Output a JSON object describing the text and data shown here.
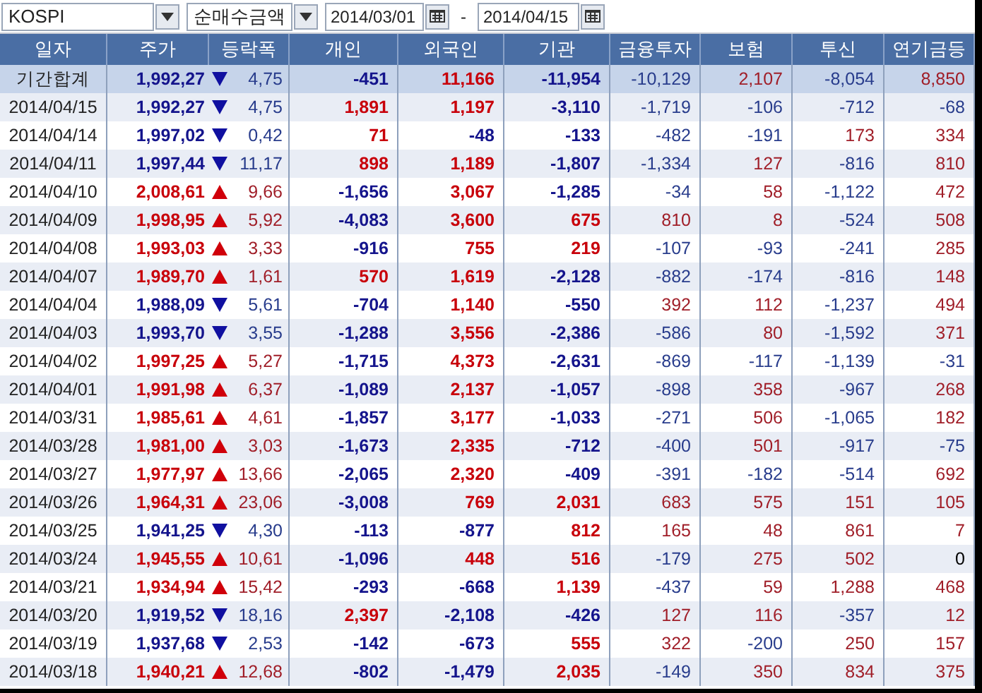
{
  "toolbar": {
    "market_select": {
      "value": "KOSPI"
    },
    "type_select": {
      "value": "순매수금액"
    },
    "date_from": {
      "value": "2014/03/01"
    },
    "separator": "-",
    "date_to": {
      "value": "2014/04/15"
    }
  },
  "table": {
    "columns": [
      "일자",
      "주가",
      "등락폭",
      "개인",
      "외국인",
      "기관",
      "금융투자",
      "보험",
      "투신",
      "연기금등"
    ],
    "rows": [
      {
        "kind": "total",
        "date": "기간합계",
        "price": "1,992,27",
        "rising": false,
        "change": "4,75",
        "values": [
          "-451",
          "11,166",
          "-11,954",
          "-10,129",
          "2,107",
          "-8,054",
          "8,850"
        ]
      },
      {
        "kind": "day",
        "date": "2014/04/15",
        "price": "1,992,27",
        "rising": false,
        "change": "4,75",
        "values": [
          "1,891",
          "1,197",
          "-3,110",
          "-1,719",
          "-106",
          "-712",
          "-68"
        ]
      },
      {
        "kind": "day",
        "date": "2014/04/14",
        "price": "1,997,02",
        "rising": false,
        "change": "0,42",
        "values": [
          "71",
          "-48",
          "-133",
          "-482",
          "-191",
          "173",
          "334"
        ]
      },
      {
        "kind": "day",
        "date": "2014/04/11",
        "price": "1,997,44",
        "rising": false,
        "change": "11,17",
        "values": [
          "898",
          "1,189",
          "-1,807",
          "-1,334",
          "127",
          "-816",
          "810"
        ]
      },
      {
        "kind": "day",
        "date": "2014/04/10",
        "price": "2,008,61",
        "rising": true,
        "change": "9,66",
        "values": [
          "-1,656",
          "3,067",
          "-1,285",
          "-34",
          "58",
          "-1,122",
          "472"
        ]
      },
      {
        "kind": "day",
        "date": "2014/04/09",
        "price": "1,998,95",
        "rising": true,
        "change": "5,92",
        "values": [
          "-4,083",
          "3,600",
          "675",
          "810",
          "8",
          "-524",
          "508"
        ]
      },
      {
        "kind": "day",
        "date": "2014/04/08",
        "price": "1,993,03",
        "rising": true,
        "change": "3,33",
        "values": [
          "-916",
          "755",
          "219",
          "-107",
          "-93",
          "-241",
          "285"
        ]
      },
      {
        "kind": "day",
        "date": "2014/04/07",
        "price": "1,989,70",
        "rising": true,
        "change": "1,61",
        "values": [
          "570",
          "1,619",
          "-2,128",
          "-882",
          "-174",
          "-816",
          "148"
        ]
      },
      {
        "kind": "day",
        "date": "2014/04/04",
        "price": "1,988,09",
        "rising": false,
        "change": "5,61",
        "values": [
          "-704",
          "1,140",
          "-550",
          "392",
          "112",
          "-1,237",
          "494"
        ]
      },
      {
        "kind": "day",
        "date": "2014/04/03",
        "price": "1,993,70",
        "rising": false,
        "change": "3,55",
        "values": [
          "-1,288",
          "3,556",
          "-2,386",
          "-586",
          "80",
          "-1,592",
          "371"
        ]
      },
      {
        "kind": "day",
        "date": "2014/04/02",
        "price": "1,997,25",
        "rising": true,
        "change": "5,27",
        "values": [
          "-1,715",
          "4,373",
          "-2,631",
          "-869",
          "-117",
          "-1,139",
          "-31"
        ]
      },
      {
        "kind": "day",
        "date": "2014/04/01",
        "price": "1,991,98",
        "rising": true,
        "change": "6,37",
        "values": [
          "-1,089",
          "2,137",
          "-1,057",
          "-898",
          "358",
          "-967",
          "268"
        ]
      },
      {
        "kind": "day",
        "date": "2014/03/31",
        "price": "1,985,61",
        "rising": true,
        "change": "4,61",
        "values": [
          "-1,857",
          "3,177",
          "-1,033",
          "-271",
          "506",
          "-1,065",
          "182"
        ]
      },
      {
        "kind": "day",
        "date": "2014/03/28",
        "price": "1,981,00",
        "rising": true,
        "change": "3,03",
        "values": [
          "-1,673",
          "2,335",
          "-712",
          "-400",
          "501",
          "-917",
          "-75"
        ]
      },
      {
        "kind": "day",
        "date": "2014/03/27",
        "price": "1,977,97",
        "rising": true,
        "change": "13,66",
        "values": [
          "-2,065",
          "2,320",
          "-409",
          "-391",
          "-182",
          "-514",
          "692"
        ]
      },
      {
        "kind": "day",
        "date": "2014/03/26",
        "price": "1,964,31",
        "rising": true,
        "change": "23,06",
        "values": [
          "-3,008",
          "769",
          "2,031",
          "683",
          "575",
          "151",
          "105"
        ]
      },
      {
        "kind": "day",
        "date": "2014/03/25",
        "price": "1,941,25",
        "rising": false,
        "change": "4,30",
        "values": [
          "-113",
          "-877",
          "812",
          "165",
          "48",
          "861",
          "7"
        ]
      },
      {
        "kind": "day",
        "date": "2014/03/24",
        "price": "1,945,55",
        "rising": true,
        "change": "10,61",
        "values": [
          "-1,096",
          "448",
          "516",
          "-179",
          "275",
          "502",
          "0"
        ]
      },
      {
        "kind": "day",
        "date": "2014/03/21",
        "price": "1,934,94",
        "rising": true,
        "change": "15,42",
        "values": [
          "-293",
          "-668",
          "1,139",
          "-437",
          "59",
          "1,288",
          "468"
        ]
      },
      {
        "kind": "day",
        "date": "2014/03/20",
        "price": "1,919,52",
        "rising": false,
        "change": "18,16",
        "values": [
          "2,397",
          "-2,108",
          "-426",
          "127",
          "116",
          "-357",
          "12"
        ]
      },
      {
        "kind": "day",
        "date": "2014/03/19",
        "price": "1,937,68",
        "rising": false,
        "change": "2,53",
        "values": [
          "-142",
          "-673",
          "555",
          "322",
          "-200",
          "250",
          "157"
        ]
      },
      {
        "kind": "day",
        "date": "2014/03/18",
        "price": "1,940,21",
        "rising": true,
        "change": "12,68",
        "values": [
          "-802",
          "-1,479",
          "2,035",
          "-149",
          "350",
          "834",
          "375"
        ]
      }
    ]
  }
}
